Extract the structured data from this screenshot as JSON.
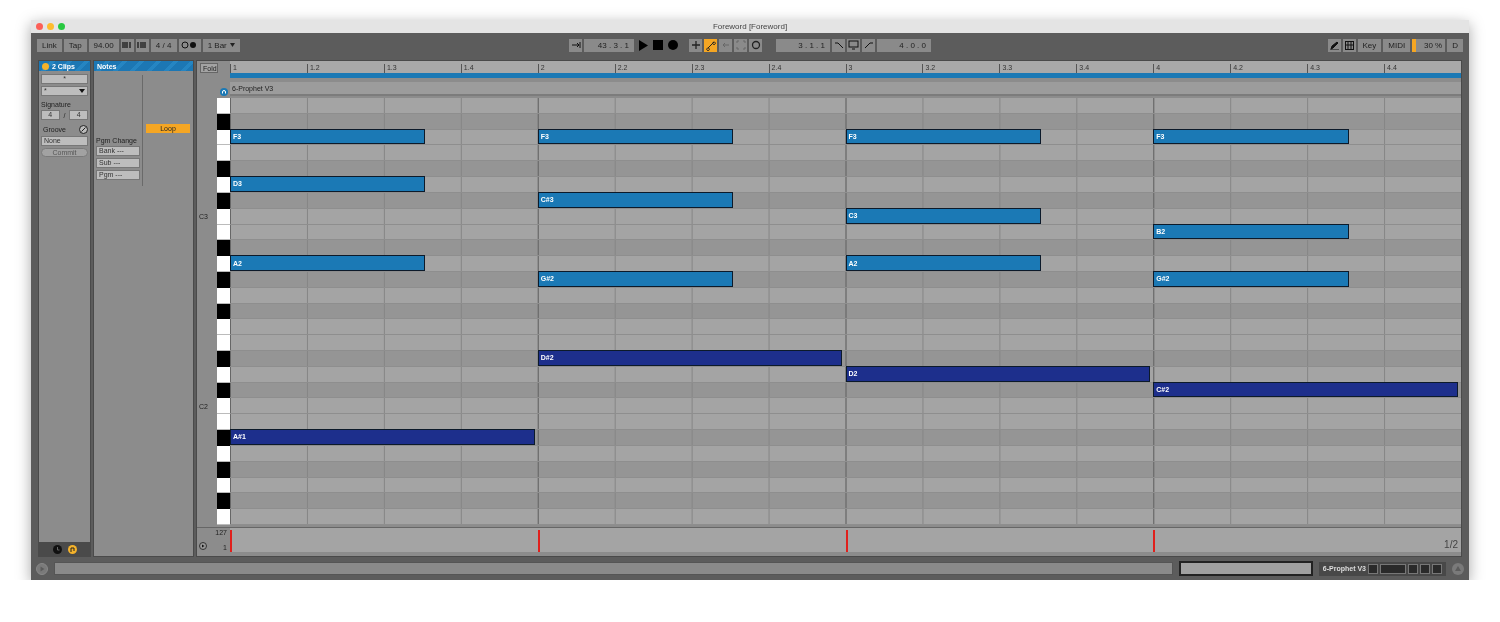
{
  "window": {
    "title": "Foreword  [Foreword]"
  },
  "toolbar": {
    "link": "Link",
    "tap": "Tap",
    "tempo": "94.00",
    "signature": "4 / 4",
    "quantize": "1 Bar",
    "position": "43 . 3 . 1",
    "loop_start": "3 . 1 . 1",
    "loop_length": "4 . 0 . 0",
    "toggles": [
      {
        "kind": "plus",
        "on": false
      },
      {
        "kind": "chain",
        "on": true
      },
      {
        "kind": "back",
        "on": false
      },
      {
        "kind": "capture",
        "on": false
      },
      {
        "kind": "ring",
        "on": false
      }
    ],
    "key": "Key",
    "midi": "MIDI",
    "cpu": {
      "reading": "30 %",
      "level": 0.12
    },
    "drive": "D"
  },
  "clip_panel": {
    "title": "2 Clips",
    "name_field": "*",
    "color_field": "*",
    "signature_label": "Signature",
    "signature": {
      "numerator": "4",
      "separator": "/",
      "denominator": "4"
    },
    "groove_label": "Groove",
    "groove": "None",
    "commit": {
      "label": "Commit",
      "disabled": true
    }
  },
  "notes_panel": {
    "title": "Notes",
    "loop": {
      "label": "Loop",
      "on": true
    },
    "program_label": "Pgm Change",
    "program_fields": [
      "Bank ---",
      "Sub ---",
      "Pgm ---"
    ]
  },
  "editor": {
    "fold": "Fold",
    "track": "6-Prophet V3",
    "ruler": [
      "1",
      "1.2",
      "1.3",
      "1.4",
      "2",
      "2.2",
      "2.3",
      "2.4",
      "3",
      "3.2",
      "3.3",
      "3.4",
      "4",
      "4.2",
      "4.3",
      "4.4"
    ],
    "lanes": [
      {
        "kind": "white"
      },
      {
        "kind": "black"
      },
      {
        "kind": "white",
        "bars": [
          {
            "kind": "short",
            "label": "F3",
            "color": "#1b79b5"
          },
          {
            "kind": "short",
            "label": "F3",
            "color": "#1b79b5"
          },
          {
            "kind": "short",
            "label": "F3",
            "color": "#1b79b5"
          },
          {
            "kind": "short",
            "label": "F3",
            "color": "#1b79b5"
          }
        ]
      },
      {
        "kind": "white"
      },
      {
        "kind": "black"
      },
      {
        "kind": "white",
        "bars": [
          {
            "kind": "short",
            "label": "D3",
            "color": "#1b79b5"
          },
          {
            "kind": "rest"
          },
          {
            "kind": "rest"
          },
          {
            "kind": "rest"
          }
        ]
      },
      {
        "kind": "black",
        "bars": [
          {
            "kind": "rest"
          },
          {
            "kind": "short",
            "label": "C#3",
            "color": "#1b79b5"
          },
          {
            "kind": "rest"
          },
          {
            "kind": "rest"
          }
        ]
      },
      {
        "kind": "white",
        "octave": "C3",
        "bars": [
          {
            "kind": "rest"
          },
          {
            "kind": "rest"
          },
          {
            "kind": "short",
            "label": "C3",
            "color": "#1b79b5"
          },
          {
            "kind": "rest"
          }
        ]
      },
      {
        "kind": "white",
        "bars": [
          {
            "kind": "rest"
          },
          {
            "kind": "rest"
          },
          {
            "kind": "rest"
          },
          {
            "kind": "short",
            "label": "B2",
            "color": "#1b79b5"
          }
        ]
      },
      {
        "kind": "black"
      },
      {
        "kind": "white",
        "bars": [
          {
            "kind": "short",
            "label": "A2",
            "color": "#1b79b5"
          },
          {
            "kind": "rest"
          },
          {
            "kind": "short",
            "label": "A2",
            "color": "#1b79b5"
          },
          {
            "kind": "rest"
          }
        ]
      },
      {
        "kind": "black",
        "bars": [
          {
            "kind": "rest"
          },
          {
            "kind": "short",
            "label": "G#2",
            "color": "#1b79b5"
          },
          {
            "kind": "rest"
          },
          {
            "kind": "short",
            "label": "G#2",
            "color": "#1b79b5"
          }
        ]
      },
      {
        "kind": "white"
      },
      {
        "kind": "black"
      },
      {
        "kind": "white"
      },
      {
        "kind": "white"
      },
      {
        "kind": "black",
        "bars": [
          {
            "kind": "rest"
          },
          {
            "kind": "long",
            "label": "D#2",
            "color": "#1d2f8c"
          },
          {
            "kind": "rest"
          },
          {
            "kind": "rest"
          }
        ]
      },
      {
        "kind": "white",
        "bars": [
          {
            "kind": "rest"
          },
          {
            "kind": "rest"
          },
          {
            "kind": "long",
            "label": "D2",
            "color": "#1d2f8c"
          },
          {
            "kind": "rest"
          }
        ]
      },
      {
        "kind": "black",
        "bars": [
          {
            "kind": "rest"
          },
          {
            "kind": "rest"
          },
          {
            "kind": "rest"
          },
          {
            "kind": "long",
            "label": "C#2",
            "color": "#1d2f8c"
          }
        ]
      },
      {
        "kind": "white",
        "octave": "C2"
      },
      {
        "kind": "white"
      },
      {
        "kind": "black",
        "bars": [
          {
            "kind": "long",
            "label": "A#1",
            "color": "#1d2f8c"
          },
          {
            "kind": "rest"
          },
          {
            "kind": "rest"
          },
          {
            "kind": "rest"
          }
        ]
      },
      {
        "kind": "white"
      },
      {
        "kind": "black"
      },
      {
        "kind": "white"
      },
      {
        "kind": "black"
      },
      {
        "kind": "white"
      }
    ],
    "velocity": {
      "max": "127",
      "min": "1",
      "page": "1/2"
    }
  },
  "status_bar": {
    "track": "6-Prophet V3"
  }
}
